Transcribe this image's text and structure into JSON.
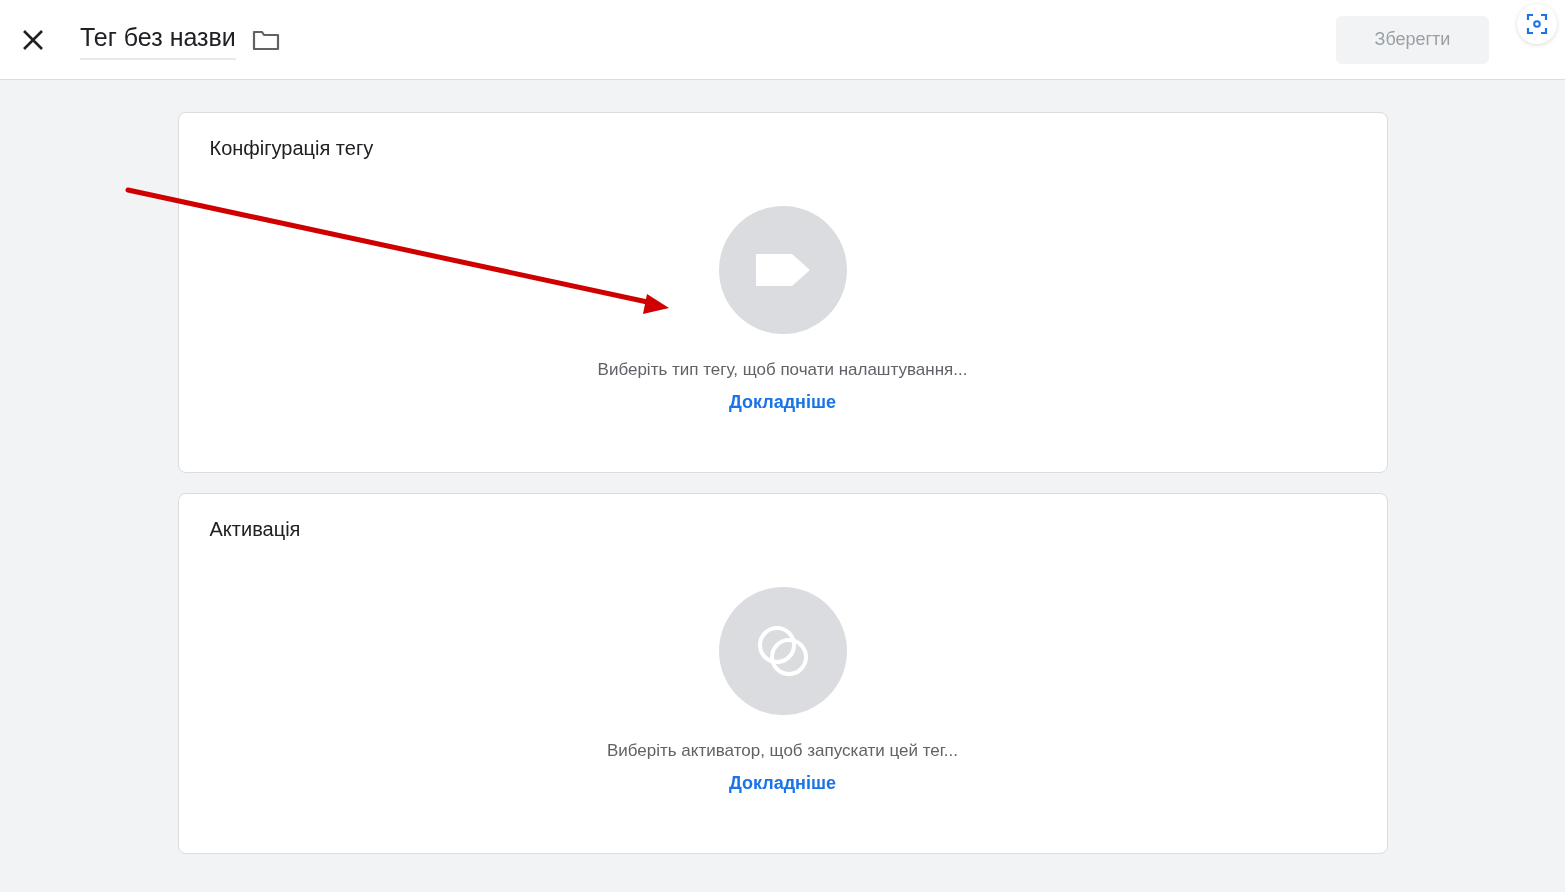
{
  "header": {
    "title": "Тег без назви",
    "save_button": {
      "label": "Зберегти",
      "disabled": true
    }
  },
  "cards": [
    {
      "kind": "tag",
      "title": "Конфігурація тегу",
      "hint": "Виберіть тип тегу, щоб почати налаштування...",
      "link": "Докладніше"
    },
    {
      "kind": "trigger",
      "title": "Активація",
      "hint": "Виберіть активатор, щоб запускати цей тег...",
      "link": "Докладніше"
    }
  ]
}
